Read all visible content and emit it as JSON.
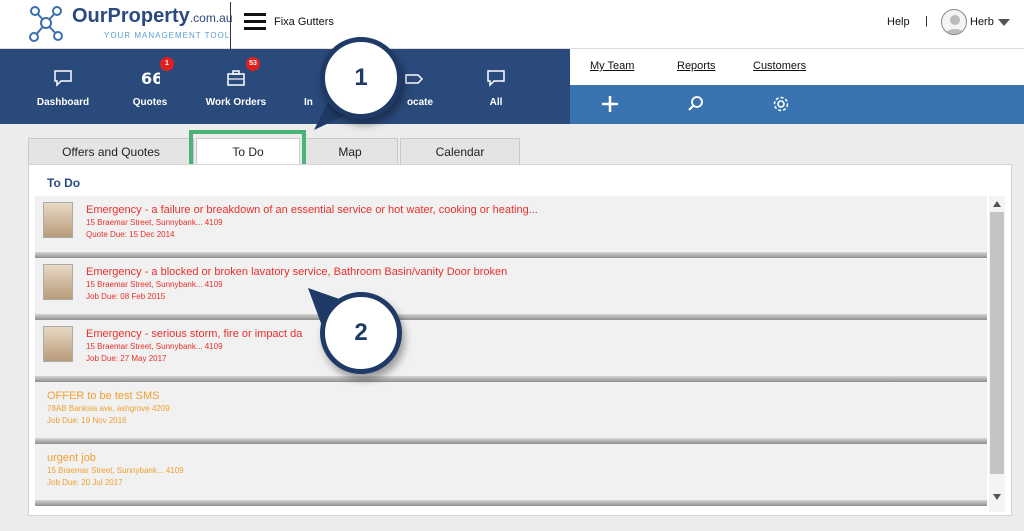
{
  "header": {
    "brand_name": "OurProperty",
    "brand_domain": ".com.au",
    "brand_tagline": "YOUR MANAGEMENT TOOL",
    "company": "Fixa Gutters",
    "help": "Help",
    "separator": "|",
    "user": "Herb"
  },
  "nav": {
    "items": [
      {
        "label": "Dashboard",
        "icon": "speech-bubble-icon"
      },
      {
        "label": "Quotes",
        "icon": "quote-icon",
        "badge": "1"
      },
      {
        "label": "Work Orders",
        "icon": "briefcase-icon",
        "badge": "53"
      },
      {
        "label": "In",
        "icon": "invoice-icon"
      },
      {
        "label": "ocate",
        "icon": "locate-icon"
      },
      {
        "label": "All",
        "icon": "speech-bubble-icon"
      }
    ],
    "links": [
      "My Team",
      "Reports",
      "Customers"
    ],
    "actions": [
      "add-icon",
      "search-icon",
      "gear-icon"
    ]
  },
  "tabs": [
    {
      "label": "Offers and Quotes",
      "active": false
    },
    {
      "label": "To Do",
      "active": true
    },
    {
      "label": "Map",
      "active": false
    },
    {
      "label": "Calendar",
      "active": false
    }
  ],
  "panel": {
    "title": "To Do",
    "items": [
      {
        "title": "Emergency - a failure or breakdown of an essential service or hot water, cooking or heating...",
        "address": "15 Braemar Street, Sunnybank... 4109",
        "due": "Quote Due: 15 Dec 2014",
        "color": "#e8302c",
        "has_avatar": true
      },
      {
        "title": "Emergency - a blocked or broken lavatory service, Bathroom Basin/vanity Door broken",
        "address": "15 Braemar Street, Sunnybank... 4109",
        "due": "Job Due: 08 Feb 2015",
        "color": "#e8302c",
        "has_avatar": true
      },
      {
        "title": "Emergency - serious storm, fire or impact da",
        "address": "15 Braemar Street, Sunnybank... 4109",
        "due": "Job Due: 27 May 2017",
        "color": "#e8302c",
        "has_avatar": true
      },
      {
        "title": "OFFER to be test SMS",
        "address": "78AB Banksia ave, ashgrove 4209",
        "due": "Job Due: 19 Nov 2016",
        "color": "#f0a030",
        "has_avatar": false
      },
      {
        "title": "urgent job",
        "address": "15 Braemar Street, Sunnybank... 4109",
        "due": "Job Due: 20 Jul 2017",
        "color": "#f0a030",
        "has_avatar": false
      }
    ]
  },
  "callouts": [
    "1",
    "2"
  ]
}
